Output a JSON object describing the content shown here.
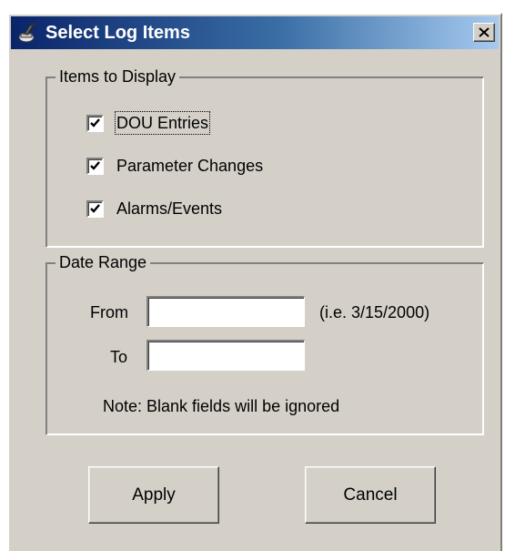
{
  "window": {
    "title": "Select Log Items",
    "icon": "log-items-icon",
    "close_glyph": "close-icon"
  },
  "items_group": {
    "legend": "Items to Display",
    "items": [
      {
        "label": "DOU Entries",
        "checked": true
      },
      {
        "label": "Parameter Changes",
        "checked": true
      },
      {
        "label": "Alarms/Events",
        "checked": true
      }
    ]
  },
  "date_group": {
    "legend": "Date Range",
    "from_label": "From",
    "from_value": "",
    "from_hint": "(i.e. 3/15/2000)",
    "to_label": "To",
    "to_value": "",
    "note": "Note: Blank fields will be ignored"
  },
  "buttons": {
    "apply": "Apply",
    "cancel": "Cancel"
  },
  "colors": {
    "title_bar_start": "#0a246a",
    "title_bar_end": "#a6caf0",
    "dialog_face": "#d4d0c8"
  }
}
